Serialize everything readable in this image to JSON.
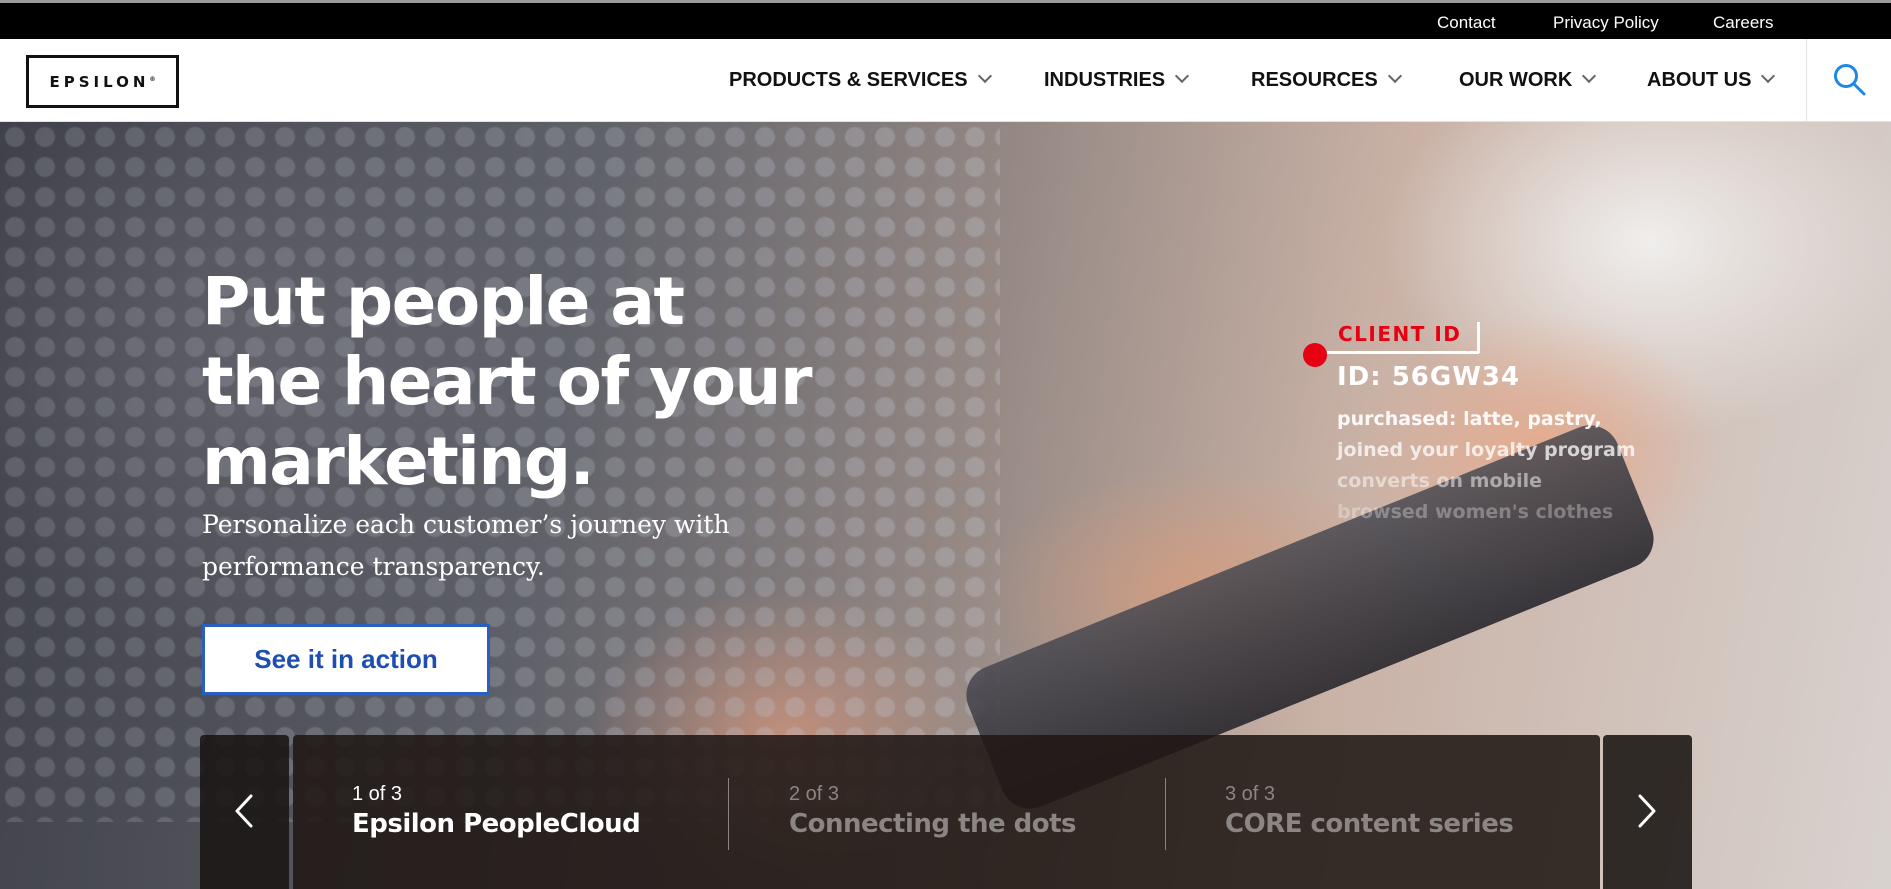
{
  "utility_nav": {
    "contact": "Contact",
    "privacy": "Privacy Policy",
    "careers": "Careers"
  },
  "header": {
    "logo_text": "EPSILON",
    "logo_mark": "®",
    "nav": [
      {
        "label": "PRODUCTS & SERVICES"
      },
      {
        "label": "INDUSTRIES"
      },
      {
        "label": "RESOURCES"
      },
      {
        "label": "OUR WORK"
      },
      {
        "label": "ABOUT US"
      }
    ],
    "search_icon": "search-icon",
    "accent_color": "#1e88e5"
  },
  "hero": {
    "headline": "Put people at the heart of your marketing.",
    "subhead": "Personalize each customer’s journey with performance transparency.",
    "cta_label": "See it in action",
    "cta_color": "#1e4fb0"
  },
  "client_overlay": {
    "label": "CLIENT ID",
    "id": "ID: 56GW34",
    "notes": [
      "purchased: latte, pastry,",
      "joined your loyalty program",
      "converts on mobile",
      "browsed women's clothes"
    ],
    "accent_color": "#e60012"
  },
  "carousel": {
    "prev_icon": "chevron-left-icon",
    "next_icon": "chevron-right-icon",
    "slides": [
      {
        "num": "1 of 3",
        "title": "Epsilon PeopleCloud",
        "active": true
      },
      {
        "num": "2 of 3",
        "title": "Connecting the dots",
        "active": false
      },
      {
        "num": "3 of 3",
        "title": "CORE content series",
        "active": false
      }
    ]
  }
}
